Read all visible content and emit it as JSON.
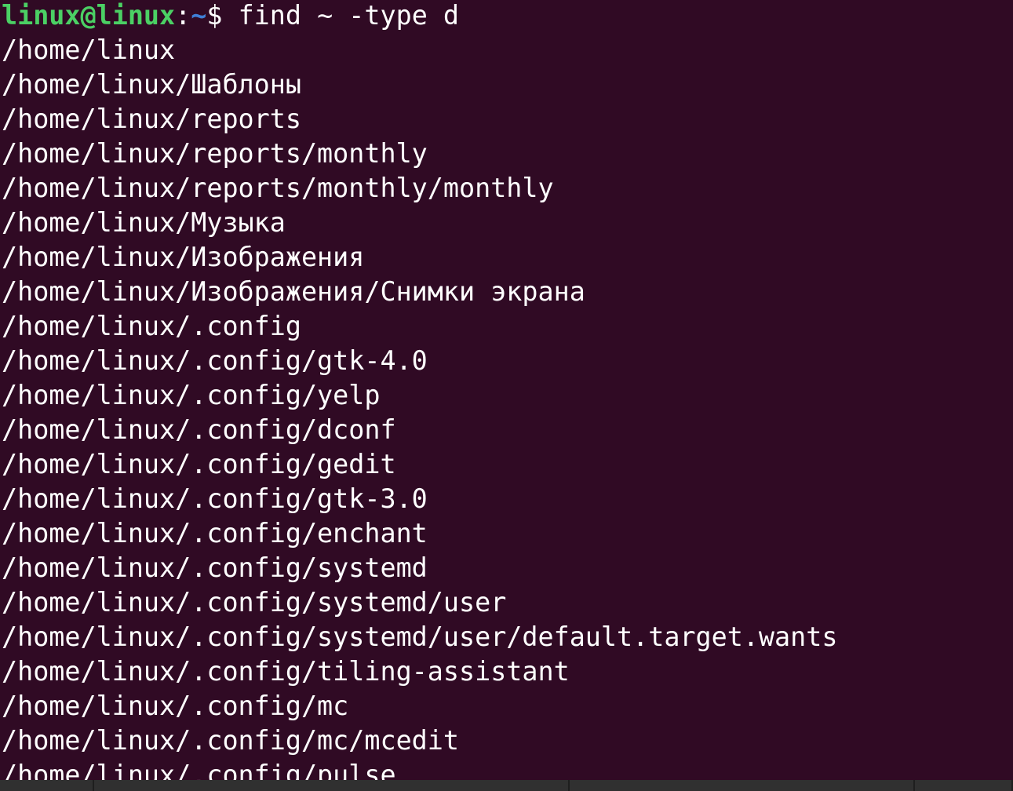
{
  "prompt": {
    "user_host": "linux@linux",
    "separator": ":",
    "path": "~",
    "dollar": "$",
    "command": " find ~ -type d"
  },
  "output": [
    "/home/linux",
    "/home/linux/Шаблоны",
    "/home/linux/reports",
    "/home/linux/reports/monthly",
    "/home/linux/reports/monthly/monthly",
    "/home/linux/Музыка",
    "/home/linux/Изображения",
    "/home/linux/Изображения/Снимки экрана",
    "/home/linux/.config",
    "/home/linux/.config/gtk-4.0",
    "/home/linux/.config/yelp",
    "/home/linux/.config/dconf",
    "/home/linux/.config/gedit",
    "/home/linux/.config/gtk-3.0",
    "/home/linux/.config/enchant",
    "/home/linux/.config/systemd",
    "/home/linux/.config/systemd/user",
    "/home/linux/.config/systemd/user/default.target.wants",
    "/home/linux/.config/tiling-assistant",
    "/home/linux/.config/mc",
    "/home/linux/.config/mc/mcedit",
    "/home/linux/.config/pulse"
  ],
  "colors": {
    "background": "#300a24",
    "prompt_user": "#4bd064",
    "prompt_path": "#3f7fd6",
    "text": "#ffffff"
  }
}
